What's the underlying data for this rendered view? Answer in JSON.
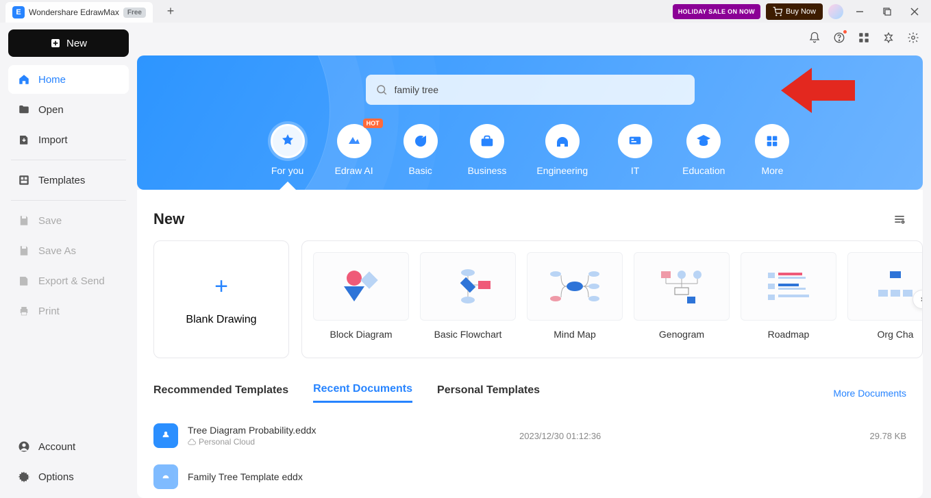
{
  "titlebar": {
    "app_name": "Wondershare EdrawMax",
    "free_badge": "Free",
    "holiday_btn": "HOLIDAY SALE ON NOW",
    "buy_btn": "Buy Now"
  },
  "sidebar": {
    "new_btn": "New",
    "items": {
      "home": "Home",
      "open": "Open",
      "import": "Import",
      "templates": "Templates",
      "save": "Save",
      "save_as": "Save As",
      "export_send": "Export & Send",
      "print": "Print",
      "account": "Account",
      "options": "Options"
    }
  },
  "hero": {
    "search_value": "family tree",
    "hot_badge": "HOT",
    "categories": {
      "for_you": "For you",
      "edraw_ai": "Edraw AI",
      "basic": "Basic",
      "business": "Business",
      "engineering": "Engineering",
      "it": "IT",
      "education": "Education",
      "more": "More"
    }
  },
  "section": {
    "new_title": "New",
    "blank_label": "Blank Drawing",
    "templates": {
      "block_diagram": "Block Diagram",
      "basic_flowchart": "Basic Flowchart",
      "mind_map": "Mind Map",
      "genogram": "Genogram",
      "roadmap": "Roadmap",
      "org_chart": "Org Cha"
    }
  },
  "tabs": {
    "recommended": "Recommended Templates",
    "recent": "Recent Documents",
    "personal": "Personal Templates",
    "more": "More Documents"
  },
  "docs": [
    {
      "name": "Tree Diagram Probability.eddx",
      "location": "Personal Cloud",
      "date": "2023/12/30 01:12:36",
      "size": "29.78 KB"
    },
    {
      "name": "Family Tree Template eddx",
      "location": "",
      "date": "",
      "size": ""
    }
  ]
}
